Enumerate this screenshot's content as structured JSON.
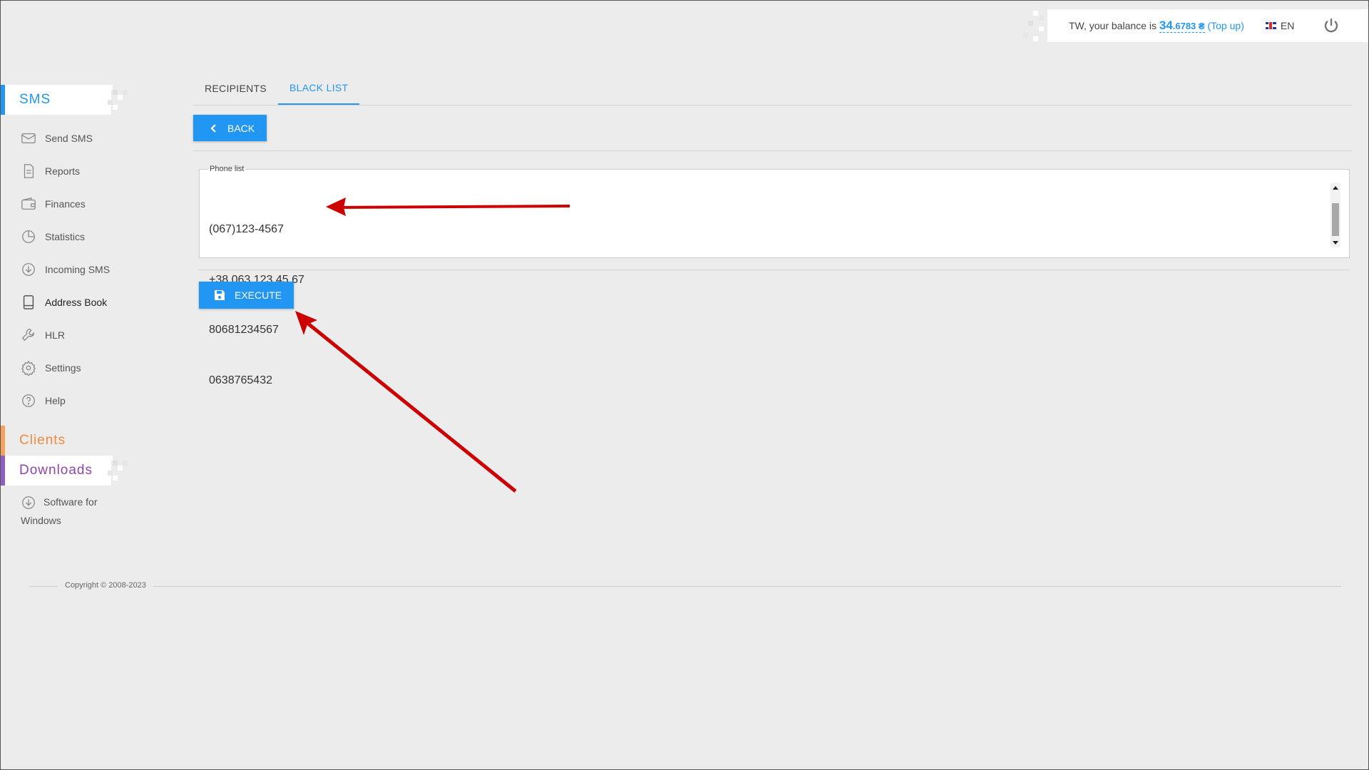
{
  "header": {
    "balance_prefix": "TW, your balance is",
    "balance_int": "34",
    "balance_dec": ".6783 ₴",
    "topup_open": "(",
    "topup_label": "Top up",
    "topup_close": ")",
    "language": "EN"
  },
  "sidebar": {
    "sms_title": "SMS",
    "items": [
      {
        "label": "Send SMS",
        "icon": "envelope-icon"
      },
      {
        "label": "Reports",
        "icon": "document-icon"
      },
      {
        "label": "Finances",
        "icon": "wallet-icon"
      },
      {
        "label": "Statistics",
        "icon": "pie-chart-icon"
      },
      {
        "label": "Incoming SMS",
        "icon": "download-circle-icon"
      },
      {
        "label": "Address Book",
        "icon": "book-icon",
        "active": true
      },
      {
        "label": "HLR",
        "icon": "wrench-icon"
      },
      {
        "label": "Settings",
        "icon": "gear-icon"
      },
      {
        "label": "Help",
        "icon": "question-icon"
      }
    ],
    "clients_title": "Clients",
    "downloads_title": "Downloads",
    "downloads_item": "Software for Windows"
  },
  "tabs": [
    {
      "label": "RECIPIENTS",
      "active": false
    },
    {
      "label": "BLACK LIST",
      "active": true
    }
  ],
  "back_button": "BACK",
  "phone_list": {
    "legend": "Phone list",
    "lines": [
      "(067)123-4567",
      "+38 063 123 45 67",
      "80681234567",
      "0638765432"
    ]
  },
  "execute_button": "EXECUTE",
  "footer": {
    "copyright": "Copyright © 2008-2023"
  },
  "colors": {
    "accent": "#2196f3",
    "clients": "#f08a3a",
    "downloads": "#8e44ad",
    "annotation_arrow": "#cc0000"
  }
}
